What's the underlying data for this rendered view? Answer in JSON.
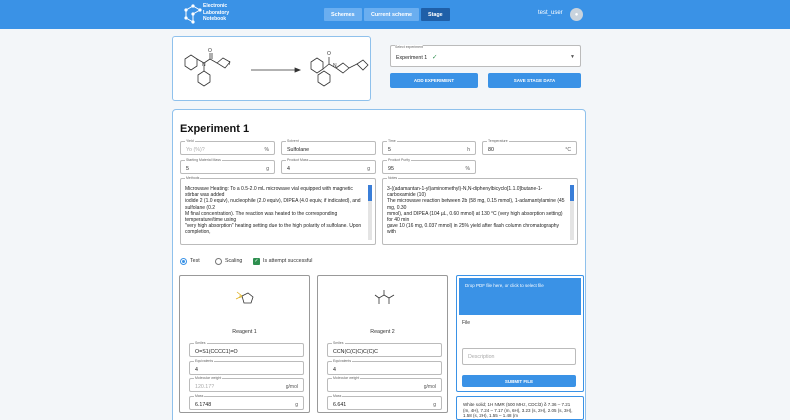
{
  "header": {
    "logo_text": [
      "Electronic",
      "Laboratory",
      "Notebook"
    ],
    "nav": [
      {
        "label": "Schemes"
      },
      {
        "label": "Current scheme"
      },
      {
        "label": "Stage"
      }
    ],
    "user": "test_user"
  },
  "experiment_select": {
    "label": "Select experiment",
    "value": "Experiment 1"
  },
  "buttons": {
    "add_experiment": "ADD EXPERIMENT",
    "save_stage": "SAVE STAGE DATA",
    "submit_file": "SUBMIT FILE"
  },
  "experiment": {
    "title": "Experiment 1",
    "fields": {
      "yield": {
        "label": "Yield",
        "placeholder": "Yo (%)?",
        "unit": "%"
      },
      "solvent": {
        "label": "Solvent",
        "value": "Sulfolane"
      },
      "time": {
        "label": "Time",
        "value": "5",
        "unit": "h"
      },
      "temperature": {
        "label": "Temperature",
        "value": "80",
        "unit": "°C"
      },
      "starting_mass": {
        "label": "Starting Material Mass",
        "value": "5",
        "unit": "g"
      },
      "product_mass": {
        "label": "Product Mass",
        "value": "4",
        "unit": "g"
      },
      "product_purity": {
        "label": "Product Purity",
        "value": "95",
        "unit": "%"
      }
    },
    "methods": {
      "label": "Methods",
      "text": "Microwave Heating: To a 0.5-2.0 mL microwave vial equipped with magnetic stirbar was added\niodide 2 (1.0 equiv), nucleophile (2.0 equiv), DIPEA (4.0 equiv, if indicated), and sulfolane (0.2\nM final concentration). The reaction was heated to the corresponding temperature/time using\n\"very high absorption\" heating setting due to the high polarity of sulfolane. Upon completion,"
    },
    "notes": {
      "label": "Notes",
      "text": "3-((adamantan-1-yl)aminomethyl)-N,N-diphenylbicyclo[1.1.0]butane-1-carboxamide (10)\nThe microwave reaction between 2b (58 mg, 0.15 mmol), 1-adamantylamine (45 mg, 0.30\nmmol), and DIPEA (104 µL, 0.60 mmol) at 130 °C (very high absorption setting) for 40 min\ngave 10 (16 mg, 0.037 mmol) in 25% yield after flash column chromatography with"
    },
    "options": {
      "test": "Test",
      "scaling": "Scaling",
      "successful": "Is attempt successful"
    }
  },
  "reagents": [
    {
      "name": "Reagent 1",
      "smiles_label": "Smiles",
      "smiles": "O=S1(CCCC1)=O",
      "equiv_label": "Equivalents",
      "equiv": "4",
      "mw_label": "Molecular weight",
      "mw_placeholder": "120.17?",
      "mw_unit": "g/mol",
      "mass_label": "Mass",
      "mass": "6.1748",
      "mass_unit": "g"
    },
    {
      "name": "Reagent 2",
      "smiles_label": "Smiles",
      "smiles": "CCN(C(C)C)C(C)C",
      "equiv_label": "Equivalents",
      "equiv": "4",
      "mw_label": "Molecular weight",
      "mw_placeholder": "",
      "mw_unit": "g/mol",
      "mass_label": "Mass",
      "mass": "6.641",
      "mass_unit": "g"
    }
  ],
  "upload": {
    "drop_text": "Drop PDF file here, or click to select file",
    "file_label": "File",
    "description_placeholder": "Description"
  },
  "nmr_text": "White solid; 1H NMR (500 MHz, CDCl3) δ 7.36 – 7.21 (m, 4H), 7.24 – 7.17 (m, 6H), 3.23 (s, 2H), 2.05 (s, 3H), 1.58 (s, 2H), 1.55 – 1.48 (m"
}
